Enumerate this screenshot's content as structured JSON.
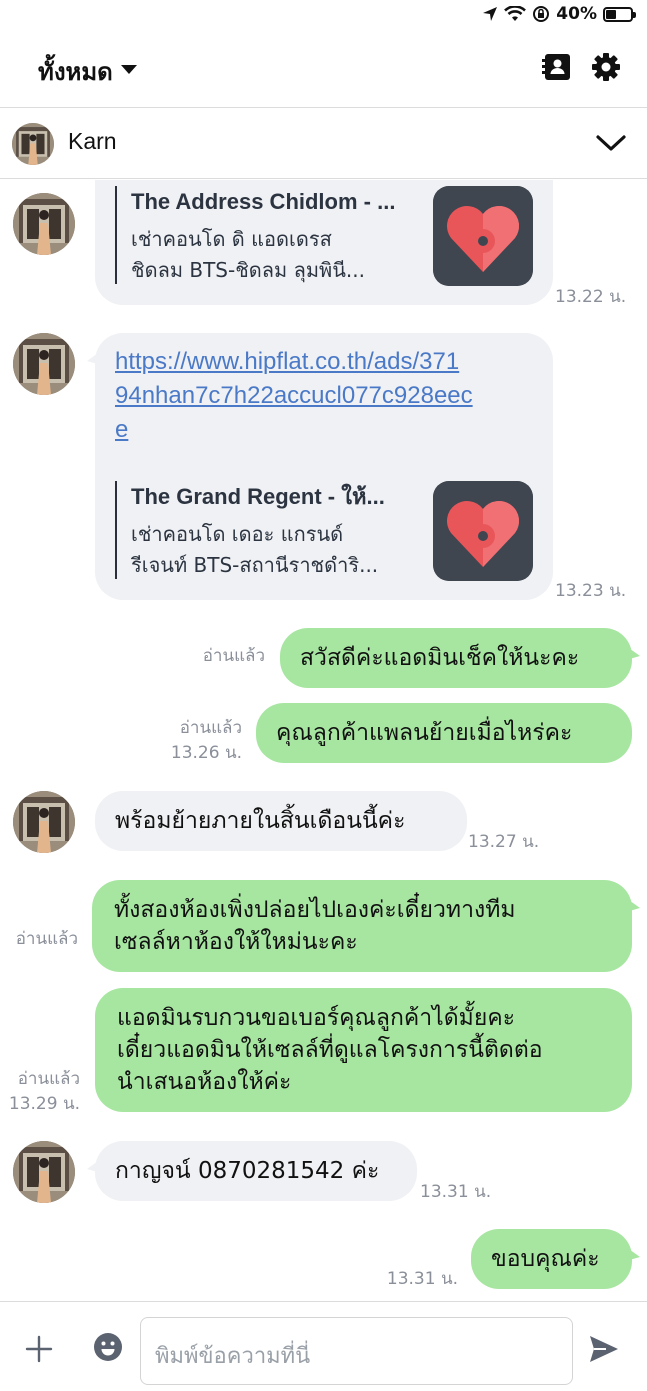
{
  "status": {
    "battery": "40%",
    "battery_level": 0.4
  },
  "header": {
    "title": "ทั้งหมด",
    "contacts_icon": "contact-book-icon",
    "settings_icon": "gear-icon"
  },
  "contact": {
    "name": "Karn"
  },
  "messages": [
    {
      "side": "in",
      "type": "preview",
      "preview_title": "The Address Chidlom - ...",
      "preview_line1": "เช่าคอนโด ดิ แอดเดรส",
      "preview_line2": "ชิดลม BTS-ชิดลม ลุมพินี...",
      "time": "13.22 น."
    },
    {
      "side": "in",
      "type": "link",
      "link_line1": "https://www.hipflat.co.th/ads/371",
      "link_line2": "94nhan7c7h22accucl077c928eec",
      "link_line3": "e",
      "preview_title": "The Grand Regent - ให้...",
      "preview_line1": "เช่าคอนโด เดอะ แกรนด์",
      "preview_line2": "รีเจนท์ BTS-สถานีราชดำริ...",
      "time": "13.23 น."
    },
    {
      "side": "out",
      "text": "สวัสดีค่ะแอดมินเช็คให้นะคะ",
      "read": "อ่านแล้ว",
      "time": ""
    },
    {
      "side": "out",
      "text": "คุณลูกค้าแพลนย้ายเมื่อไหร่คะ",
      "read": "อ่านแล้ว",
      "time": "13.26 น."
    },
    {
      "side": "in",
      "text": "พร้อมย้ายภายในสิ้นเดือนนี้ค่ะ",
      "time": "13.27 น."
    },
    {
      "side": "out",
      "line1": "ทั้งสองห้องเพิ่งปล่อยไปเองค่ะเดี๋ยวทางทีม",
      "line2": "เซลล์หาห้องให้ใหม่นะคะ",
      "read": "อ่านแล้ว",
      "time": ""
    },
    {
      "side": "out",
      "line1": "แอดมินรบกวนขอเบอร์คุณลูกค้าได้มั้ยคะ",
      "line2": "เดี๋ยวแอดมินให้เซลล์ที่ดูแลโครงการนี้ติดต่อ",
      "line3": "นำเสนอห้องให้ค่ะ",
      "read": "อ่านแล้ว",
      "time": "13.29 น."
    },
    {
      "side": "in",
      "text": "กาญจน์ 0870281542 ค่ะ",
      "time": "13.31 น."
    },
    {
      "side": "out",
      "text": "ขอบคุณค่ะ",
      "read": "",
      "time": "13.31 น."
    }
  ],
  "input": {
    "placeholder": "พิมพ์ข้อความที่นี่"
  },
  "colors": {
    "outgoing_bubble": "#a7e6a1",
    "incoming_bubble": "#f0f1f4",
    "link": "#4a79c7",
    "map_pin": "#e8565a"
  }
}
